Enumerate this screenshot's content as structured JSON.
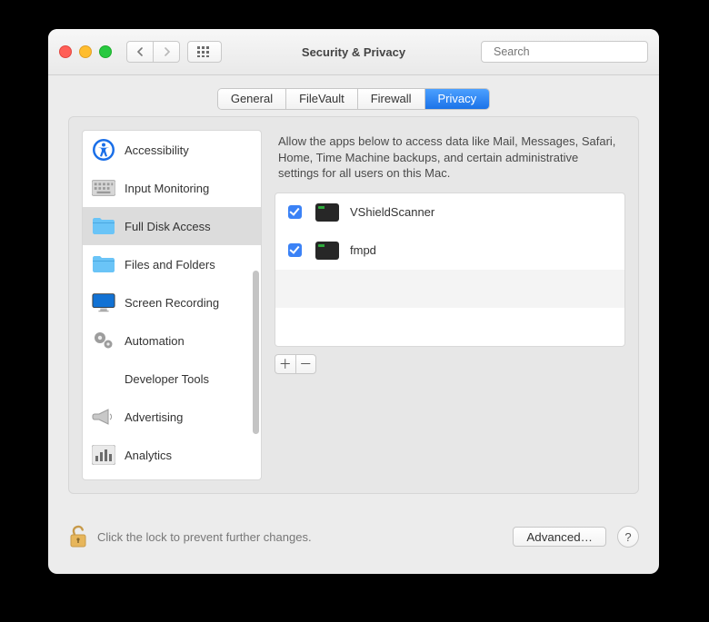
{
  "window": {
    "title": "Security & Privacy"
  },
  "search": {
    "placeholder": "Search"
  },
  "tabs": [
    {
      "label": "General",
      "active": false
    },
    {
      "label": "FileVault",
      "active": false
    },
    {
      "label": "Firewall",
      "active": false
    },
    {
      "label": "Privacy",
      "active": true
    }
  ],
  "sidebar": {
    "items": [
      {
        "label": "Accessibility",
        "icon": "accessibility",
        "selected": false
      },
      {
        "label": "Input Monitoring",
        "icon": "keyboard",
        "selected": false
      },
      {
        "label": "Full Disk Access",
        "icon": "folder",
        "selected": true
      },
      {
        "label": "Files and Folders",
        "icon": "folder",
        "selected": false
      },
      {
        "label": "Screen Recording",
        "icon": "display",
        "selected": false
      },
      {
        "label": "Automation",
        "icon": "gears",
        "selected": false
      },
      {
        "label": "Developer Tools",
        "icon": "none",
        "selected": false
      },
      {
        "label": "Advertising",
        "icon": "megaphone",
        "selected": false
      },
      {
        "label": "Analytics",
        "icon": "bars",
        "selected": false
      }
    ]
  },
  "main": {
    "description": "Allow the apps below to access data like Mail, Messages, Safari, Home, Time Machine backups, and certain administrative settings for all users on this Mac.",
    "apps": [
      {
        "name": "VShieldScanner",
        "checked": true
      },
      {
        "name": "fmpd",
        "checked": true
      }
    ]
  },
  "footer": {
    "lock_text": "Click the lock to prevent further changes.",
    "advanced_label": "Advanced…"
  }
}
